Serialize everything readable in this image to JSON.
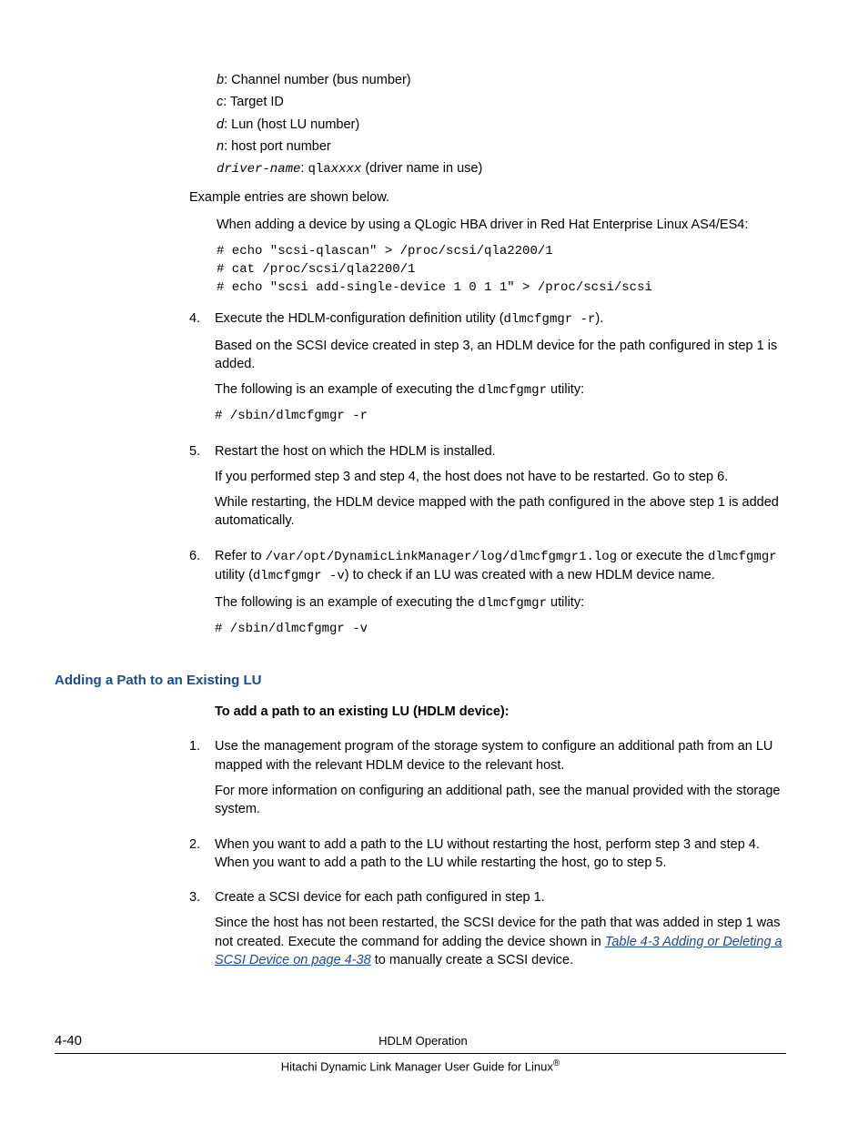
{
  "defs": {
    "b": {
      "var": "b",
      "text": ": Channel number (bus number)"
    },
    "c": {
      "var": "c",
      "text": ": Target ID"
    },
    "d": {
      "var": "d",
      "text": ": Lun (host LU number)"
    },
    "n": {
      "var": "n",
      "text": ": host port number"
    },
    "driver": {
      "var": "driver-name",
      "sep": ": ",
      "code": "qla",
      "codeital": "xxxx",
      "tail": " (driver name in use)"
    }
  },
  "example_intro": "Example entries are shown below.",
  "example_desc": "When adding a device by using a QLogic HBA driver in Red Hat Enterprise Linux AS4/ES4:",
  "example_code": "# echo \"scsi-qlascan\" > /proc/scsi/qla2200/1\n# cat /proc/scsi/qla2200/1\n# echo \"scsi add-single-device 1 0 1 1\" > /proc/scsi/scsi",
  "step4": {
    "num": "4.",
    "p1a": "Execute the HDLM-configuration definition utility (",
    "p1code": "dlmcfgmgr -r",
    "p1b": ").",
    "p2": "Based on the SCSI device created in step 3, an HDLM device for the path configured in step 1 is added.",
    "p3a": "The following is an example of executing the ",
    "p3code": "dlmcfgmgr",
    "p3b": " utility:",
    "cmd": "# /sbin/dlmcfgmgr -r"
  },
  "step5": {
    "num": "5.",
    "p1": "Restart the host on which the HDLM is installed.",
    "p2": "If you performed step 3 and step 4, the host does not have to be restarted. Go to step 6.",
    "p3": "While restarting, the HDLM device mapped with the path configured in the above step 1 is added automatically."
  },
  "step6": {
    "num": "6.",
    "p1a": "Refer to ",
    "p1path": "/var/opt/DynamicLinkManager/log/dlmcfgmgr1.log",
    "p1b": " or execute the ",
    "p1code1": "dlmcfgmgr",
    "p1c": " utility (",
    "p1code2": "dlmcfgmgr -v",
    "p1d": ") to check if an LU was created with a new HDLM device name.",
    "p2a": "The following is an example of executing the ",
    "p2code": "dlmcfgmgr",
    "p2b": " utility:",
    "cmd": "# /sbin/dlmcfgmgr -v"
  },
  "section_heading": "Adding a Path to an Existing LU",
  "bold_intro": "To add a path to an existing LU (HDLM device):",
  "b_step1": {
    "num": "1.",
    "p1": "Use the management program of the storage system to configure an additional path from an LU mapped with the relevant HDLM device to the relevant host.",
    "p2": "For more information on configuring an additional path, see the manual provided with the storage system."
  },
  "b_step2": {
    "num": "2.",
    "p1": "When you want to add a path to the LU without restarting the host, perform step 3 and step 4. When you want to add a path to the LU while restarting the host, go to step 5."
  },
  "b_step3": {
    "num": "3.",
    "p1": "Create a SCSI device for each path configured in step 1.",
    "p2a": "Since the host has not been restarted, the SCSI device for the path that was added in step 1 was not created. Execute the command for adding the device shown in ",
    "link": "Table 4-3 Adding or Deleting a SCSI Device on page 4-38",
    "p2b": " to manually create a SCSI device."
  },
  "footer": {
    "page": "4-40",
    "title": "HDLM Operation",
    "subtitle_a": "Hitachi Dynamic Link Manager User Guide for Linux",
    "reg": "®"
  }
}
